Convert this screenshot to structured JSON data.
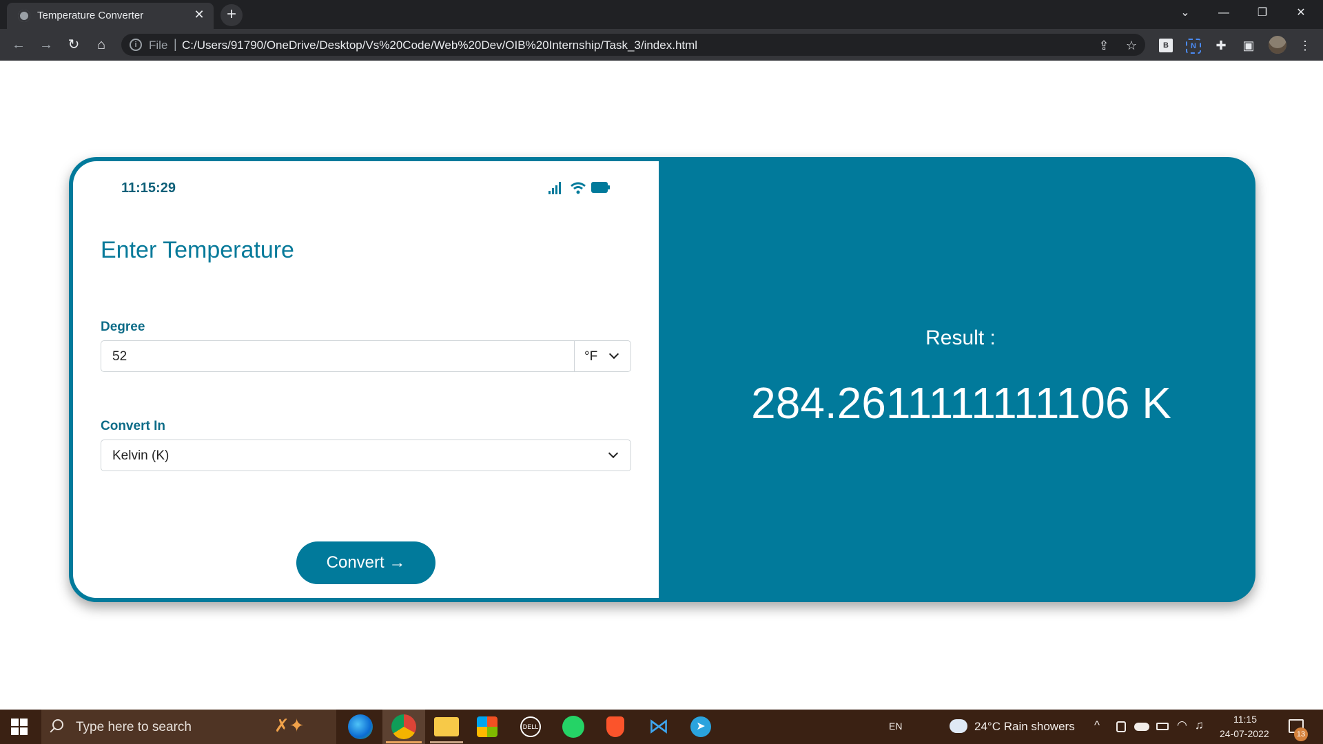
{
  "browser": {
    "tab_title": "Temperature Converter",
    "tab_close": "✕",
    "new_tab": "+",
    "address_scheme": "File",
    "address_separator": "|",
    "address_url": "C:/Users/91790/OneDrive/Desktop/Vs%20Code/Web%20Dev/OIB%20Internship/Task_3/index.html",
    "extension_b": "B",
    "extension_n": "N",
    "window_controls": [
      "⌄",
      "—",
      "❐",
      "✕"
    ]
  },
  "app": {
    "status_time": "11:15:29",
    "form_title": "Enter Temperature",
    "degree_label": "Degree",
    "degree_value": "52",
    "unit_value": "°F",
    "convert_in_label": "Convert In",
    "convert_in_value": "Kelvin (K)",
    "convert_button": "Convert →",
    "result_label": "Result :",
    "result_value": "284.2611111111106 K"
  },
  "taskbar": {
    "search_placeholder": "Type here to search",
    "language": "EN",
    "weather": "24°C  Rain showers",
    "time": "11:15",
    "date": "24-07-2022",
    "notification_count": "13"
  },
  "colors": {
    "accent": "#017a9b",
    "browser_dark": "#202124",
    "browser_mid": "#35363a",
    "taskbar": "#3a2113"
  }
}
